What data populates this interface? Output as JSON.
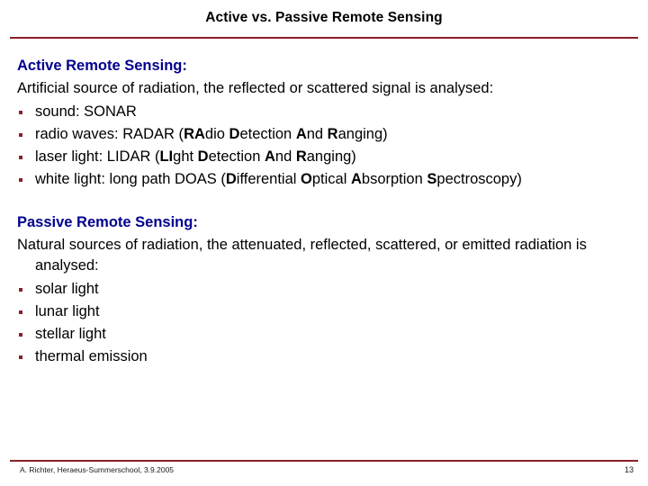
{
  "slide": {
    "title": "Active vs. Passive Remote Sensing",
    "page_number": "13",
    "footer_text": "A. Richter, Heraeus-Summerschool, 3.9.2005",
    "colors": {
      "rule": "#8b2028",
      "heading": "#00008f",
      "bullet": "#8b2028",
      "body": "#000000",
      "background": "#ffffff"
    }
  },
  "sections": [
    {
      "heading": "Active Remote Sensing:",
      "intro": "Artificial source of radiation, the reflected or scattered signal is analysed:",
      "intro_wrapped": false,
      "bullets": [
        {
          "parts": [
            {
              "text": "sound: SONAR",
              "bold": false
            }
          ]
        },
        {
          "parts": [
            {
              "text": "radio waves: RADAR (",
              "bold": false
            },
            {
              "text": "RA",
              "bold": true
            },
            {
              "text": "dio ",
              "bold": false
            },
            {
              "text": "D",
              "bold": true
            },
            {
              "text": "etection ",
              "bold": false
            },
            {
              "text": "A",
              "bold": true
            },
            {
              "text": "nd ",
              "bold": false
            },
            {
              "text": "R",
              "bold": true
            },
            {
              "text": "anging)",
              "bold": false
            }
          ]
        },
        {
          "parts": [
            {
              "text": "laser light: LIDAR (",
              "bold": false
            },
            {
              "text": "LI",
              "bold": true
            },
            {
              "text": "ght ",
              "bold": false
            },
            {
              "text": "D",
              "bold": true
            },
            {
              "text": "etection ",
              "bold": false
            },
            {
              "text": "A",
              "bold": true
            },
            {
              "text": "nd ",
              "bold": false
            },
            {
              "text": "R",
              "bold": true
            },
            {
              "text": "anging)",
              "bold": false
            }
          ]
        },
        {
          "parts": [
            {
              "text": "white light: long path DOAS (",
              "bold": false
            },
            {
              "text": "D",
              "bold": true
            },
            {
              "text": "ifferential ",
              "bold": false
            },
            {
              "text": "O",
              "bold": true
            },
            {
              "text": "ptical ",
              "bold": false
            },
            {
              "text": "A",
              "bold": true
            },
            {
              "text": "bsorption ",
              "bold": false
            },
            {
              "text": "S",
              "bold": true
            },
            {
              "text": "pectroscopy)",
              "bold": false
            }
          ]
        }
      ]
    },
    {
      "heading": "Passive Remote Sensing:",
      "intro": "Natural sources of radiation, the attenuated, reflected, scattered, or emitted radiation is analysed:",
      "intro_wrapped": true,
      "bullets": [
        {
          "parts": [
            {
              "text": "solar light",
              "bold": false
            }
          ]
        },
        {
          "parts": [
            {
              "text": "lunar light",
              "bold": false
            }
          ]
        },
        {
          "parts": [
            {
              "text": "stellar light",
              "bold": false
            }
          ]
        },
        {
          "parts": [
            {
              "text": "thermal emission",
              "bold": false
            }
          ]
        }
      ]
    }
  ]
}
